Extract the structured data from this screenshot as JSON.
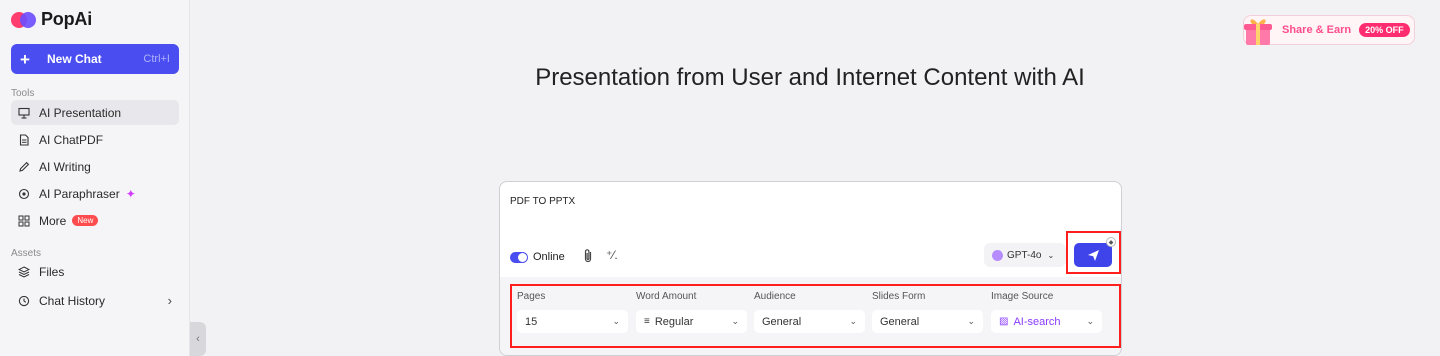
{
  "brand": {
    "name": "PopAi"
  },
  "sidebar": {
    "new_chat": {
      "label": "New Chat",
      "shortcut": "Ctrl+I"
    },
    "tools_label": "Tools",
    "tools": [
      {
        "label": "AI Presentation",
        "icon": "presentation-icon"
      },
      {
        "label": "AI ChatPDF",
        "icon": "document-icon"
      },
      {
        "label": "AI Writing",
        "icon": "pen-icon"
      },
      {
        "label": "AI Paraphraser",
        "icon": "paraphrase-icon"
      },
      {
        "label": "More",
        "icon": "grid-icon",
        "badge": "New"
      }
    ],
    "assets_label": "Assets",
    "assets": [
      {
        "label": "Files",
        "icon": "layers-icon"
      },
      {
        "label": "Chat History",
        "icon": "history-icon"
      }
    ]
  },
  "promo": {
    "label": "Share & Earn",
    "badge": "20% OFF"
  },
  "main": {
    "title": "Presentation from User and Internet Content with AI",
    "prompt": "PDF TO PPTX",
    "online_label": "Online",
    "model": "GPT-4o",
    "options": [
      {
        "label": "Pages",
        "value": "15"
      },
      {
        "label": "Word Amount",
        "value": "Regular"
      },
      {
        "label": "Audience",
        "value": "General"
      },
      {
        "label": "Slides Form",
        "value": "General"
      },
      {
        "label": "Image Source",
        "value": "AI-search"
      }
    ]
  },
  "colors": {
    "accent": "#4a4ef0",
    "highlight": "#ff1e1e",
    "promo": "#ff4d8d"
  }
}
